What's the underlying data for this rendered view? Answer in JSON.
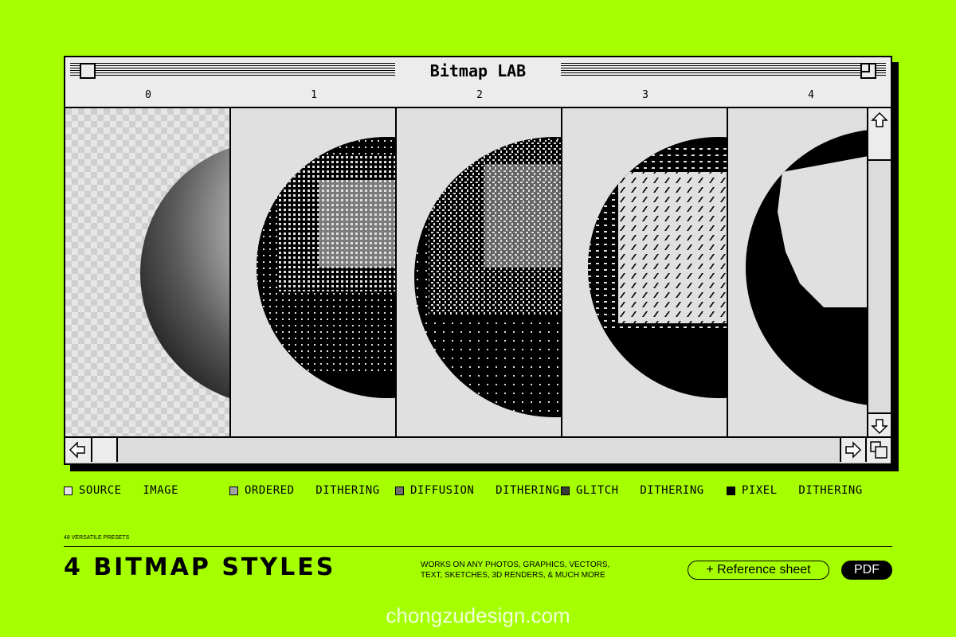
{
  "window": {
    "title": "Bitmap LAB",
    "columns": [
      "0",
      "1",
      "2",
      "3",
      "4"
    ]
  },
  "legend": [
    {
      "label": "SOURCE   IMAGE",
      "color": "#e6e6e6"
    },
    {
      "label": "ORDERED   DITHERING",
      "color": "#a3a3a3"
    },
    {
      "label": "DIFFUSION   DITHERING",
      "color": "#707070"
    },
    {
      "label": "GLITCH   DITHERING",
      "color": "#3a3a3a"
    },
    {
      "label": "PIXEL   DITHERING",
      "color": "#000000"
    }
  ],
  "footer": {
    "presets": "48 VERSATILE PRESETS",
    "title": "4 BITMAP STYLES",
    "works_line1": "WORKS ON ANY PHOTOS, GRAPHICS, VECTORS,",
    "works_line2": "TEXT, SKETCHES, 3D RENDERS, & MUCH MORE",
    "reference_button": "+ Reference sheet",
    "pdf_button": "PDF"
  },
  "watermark": "chongzudesign.com",
  "colors": {
    "background": "#a6ff00",
    "window": "#e0e0e0"
  }
}
